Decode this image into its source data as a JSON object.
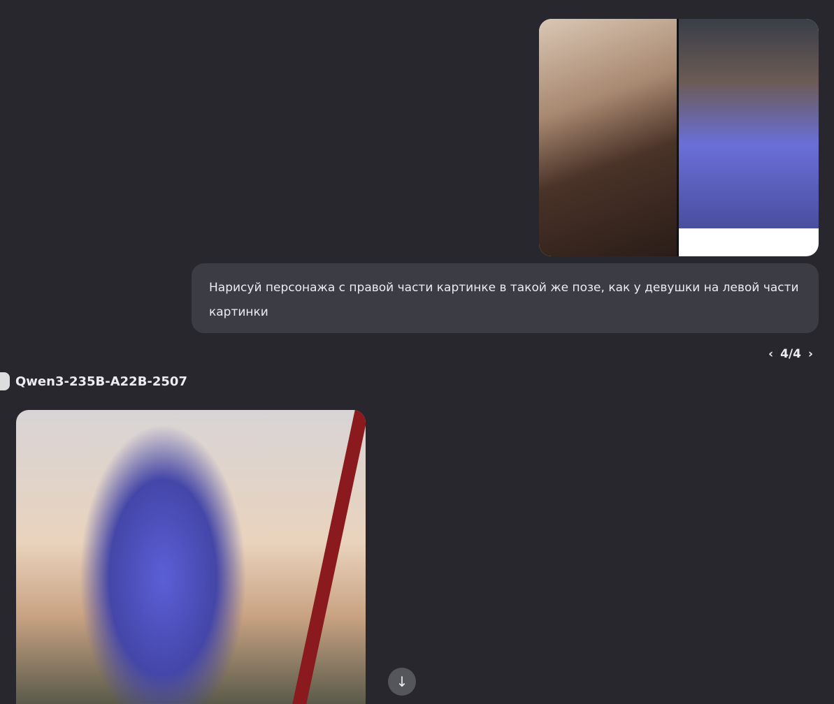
{
  "user_message": {
    "text": "Нарисуй персонажа с правой части картинке в такой же позе, как у девушки на левой части картинки"
  },
  "pager": {
    "prev": "‹",
    "label": "4/4",
    "next": "›"
  },
  "assistant": {
    "model_name": "Qwen3-235B-A22B-2507"
  },
  "scroll_down": "↓"
}
